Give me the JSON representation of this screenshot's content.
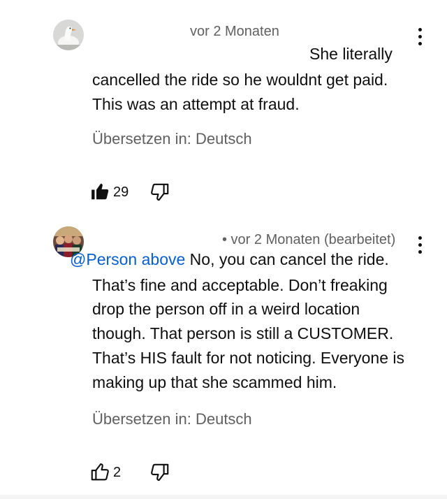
{
  "comments": [
    {
      "timestamp": "vor 2 Monaten",
      "text_lines": [
        "She literally",
        "cancelled the ride so he wouldnt get paid.",
        "This was an attempt at fraud."
      ],
      "translate_label": "Übersetzen in: Deutsch",
      "like_count": "29",
      "like_state": "liked",
      "avatar_icon": "goose-avatar-icon",
      "menu_icon": "more-vertical-icon"
    },
    {
      "timestamp": "• vor 2 Monaten (bearbeitet)",
      "mention": "@Person above",
      "text_lines": [
        "No, you can cancel the ride.",
        "That’s fine and acceptable. Don’t freaking",
        "drop the person off in a weird location",
        "though. That person is still a CUSTOMER.",
        "That’s HIS fault for not noticing. Everyone is",
        "making up that she scammed him."
      ],
      "translate_label": "Übersetzen in: Deutsch",
      "like_count": "2",
      "like_state": "not-liked",
      "avatar_icon": "group-photo-avatar-icon",
      "menu_icon": "more-vertical-icon"
    }
  ],
  "colors": {
    "text": "#0f0f0f",
    "secondary": "#606060",
    "mention": "#065fd4"
  }
}
